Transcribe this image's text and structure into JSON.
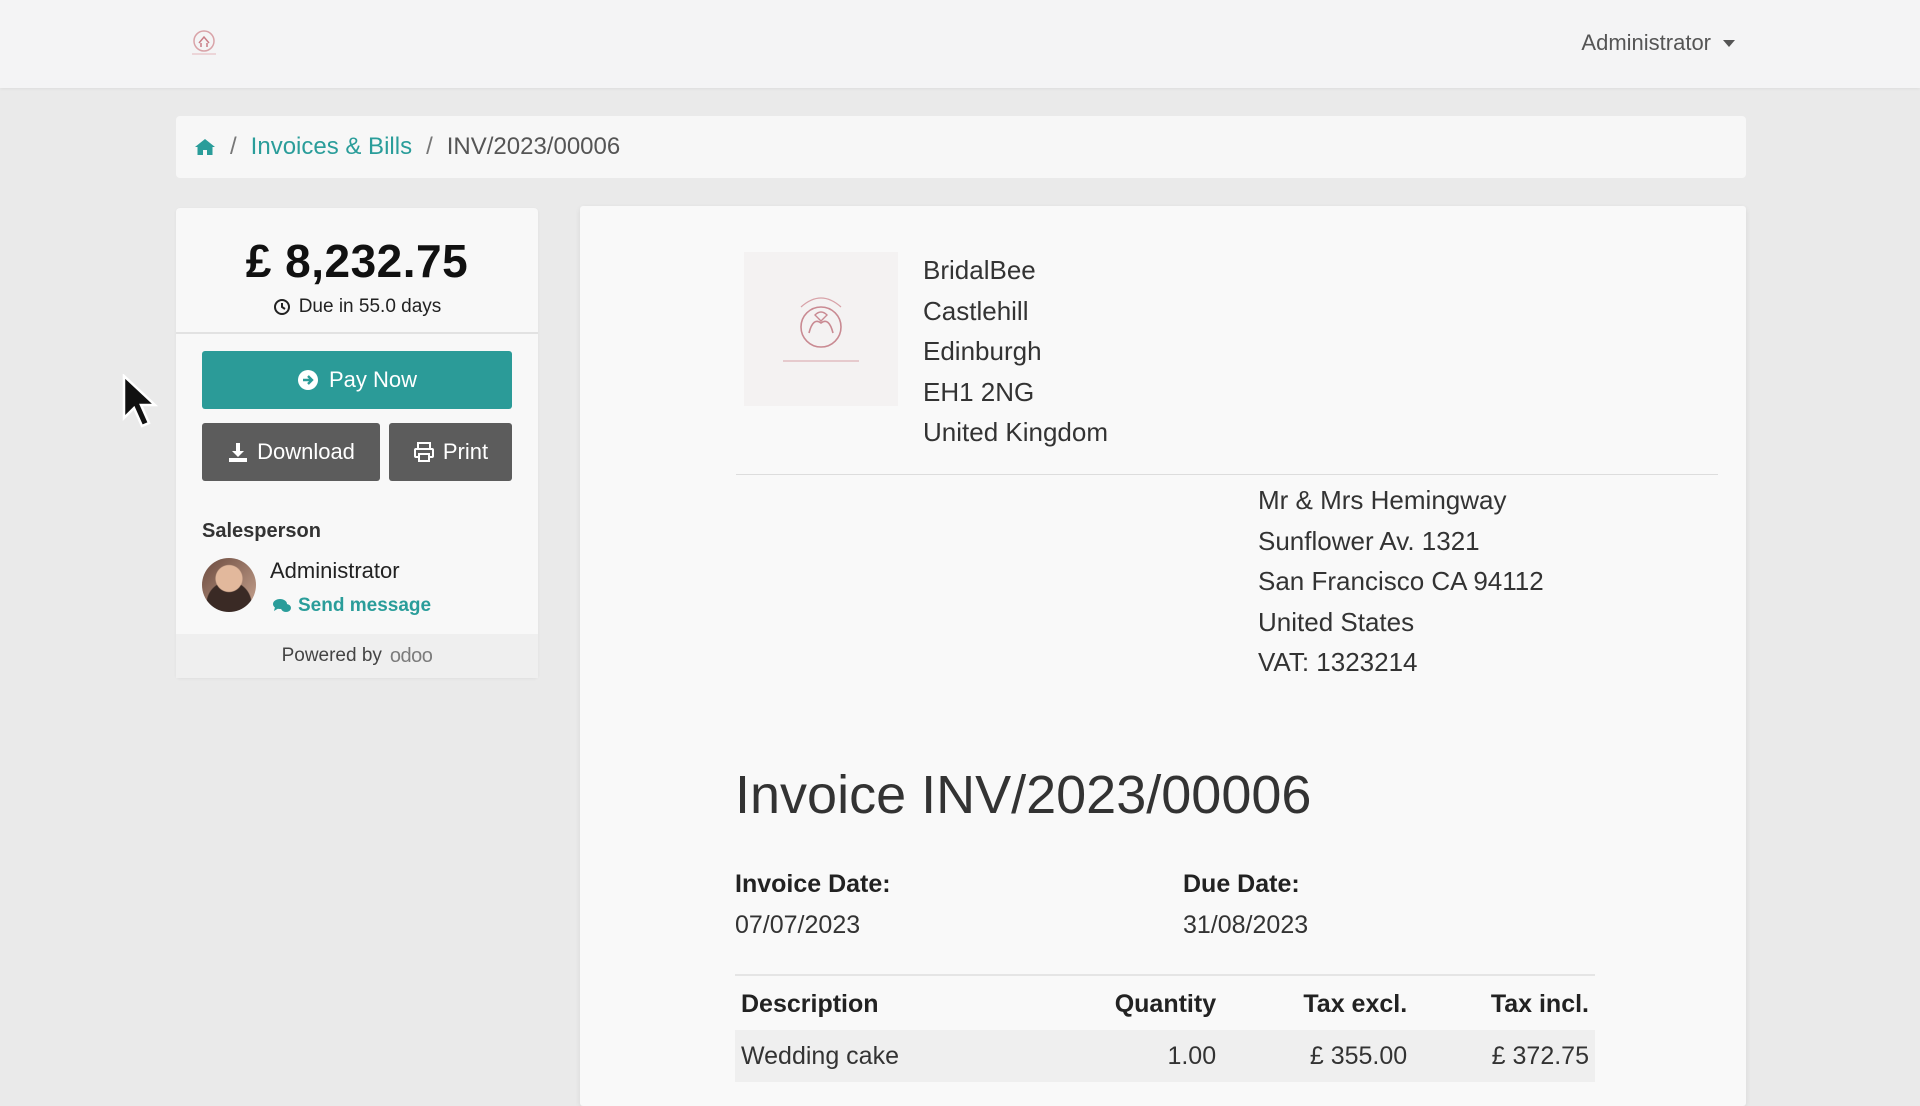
{
  "topbar": {
    "user_menu_label": "Administrator"
  },
  "breadcrumb": {
    "items": [
      "Invoices & Bills",
      "INV/2023/00006"
    ]
  },
  "summary": {
    "amount": "£ 8,232.75",
    "due_text": "Due in 55.0 days",
    "pay_label": "Pay Now",
    "download_label": "Download",
    "print_label": "Print",
    "salesperson_heading": "Salesperson",
    "salesperson_name": "Administrator",
    "send_message_label": "Send message",
    "powered_by": "Powered by",
    "powered_brand": "odoo"
  },
  "invoice": {
    "company_lines": [
      "BridalBee",
      "Castlehill",
      "Edinburgh",
      "EH1 2NG",
      "United Kingdom"
    ],
    "customer_lines": [
      "Mr & Mrs Hemingway",
      "Sunflower Av. 1321",
      "San Francisco CA 94112",
      "United States",
      "VAT: 1323214"
    ],
    "title": "Invoice INV/2023/00006",
    "invoice_date_label": "Invoice Date:",
    "invoice_date": "07/07/2023",
    "due_date_label": "Due Date:",
    "due_date": "31/08/2023",
    "columns": [
      "Description",
      "Quantity",
      "Tax excl.",
      "Tax incl."
    ],
    "rows": [
      [
        "Wedding cake",
        "1.00",
        "£ 355.00",
        "£ 372.75"
      ]
    ]
  },
  "colors": {
    "accent": "#2b9b98",
    "dark_button": "#5c5c5c",
    "link": "#2a9d9a"
  }
}
